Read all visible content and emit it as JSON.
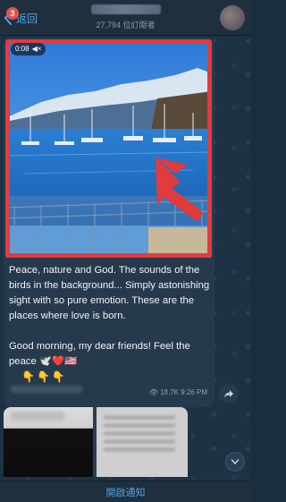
{
  "header": {
    "back_label": "返回",
    "unread_count": "3",
    "subscribers": "27,794 位訂閱者"
  },
  "video": {
    "duration": "0:08",
    "mute_icon": "speaker-muted-icon"
  },
  "message": {
    "paragraph1": "Peace, nature and God. The sounds of the birds in the background... Simply astonishing sight with so pure emotion. These are the places where love is born.",
    "paragraph2": "Good morning, my dear friends! Feel the peace 🕊️❤️🇺🇸",
    "emoji_row": "👇👇👇",
    "views": "18.7K",
    "time": "9:26 PM"
  },
  "bottom_bar": {
    "notify_label": "開啟通知"
  },
  "colors": {
    "accent": "#4fa3e3",
    "badge": "#e5524e",
    "annotation_red": "#e23b3b"
  }
}
